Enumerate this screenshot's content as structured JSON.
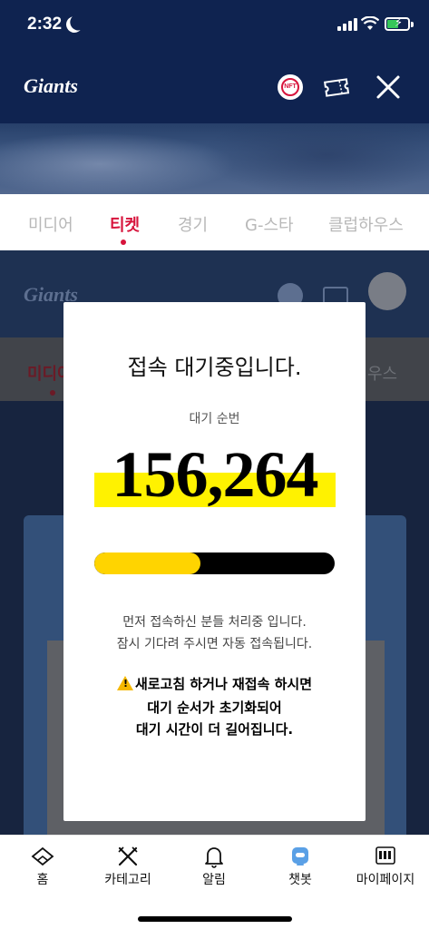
{
  "status_bar": {
    "time": "2:32"
  },
  "header": {
    "logo": "Giants",
    "nft_label": "NFT"
  },
  "tabs": [
    {
      "label": "미디어",
      "active": false
    },
    {
      "label": "티켓",
      "active": true
    },
    {
      "label": "경기",
      "active": false
    },
    {
      "label": "G-스타",
      "active": false
    },
    {
      "label": "클럽하우스",
      "active": false
    }
  ],
  "background_page": {
    "logo": "Giants",
    "tab_left": "미디어",
    "tab_right": "우스"
  },
  "modal": {
    "title": "접속 대기중입니다.",
    "queue_label": "대기 순번",
    "queue_number": "156,264",
    "progress_percent": 44,
    "note_line1": "먼저 접속하신 분들 처리중 입니다.",
    "note_line2": "잠시 기다려 주시면 자동 접속됩니다.",
    "warning_line1": "새로고침 하거나 재접속 하시면",
    "warning_line2": "대기 순서가 초기화되어",
    "warning_line3": "대기 시간이 더 길어집니다."
  },
  "bottom_nav": [
    {
      "label": "홈",
      "icon": "home-icon"
    },
    {
      "label": "카테고리",
      "icon": "category-icon"
    },
    {
      "label": "알림",
      "icon": "bell-icon"
    },
    {
      "label": "챗봇",
      "icon": "chatbot-icon"
    },
    {
      "label": "마이페이지",
      "icon": "mypage-icon"
    }
  ],
  "colors": {
    "brand_navy": "#0f2350",
    "accent_red": "#d7143c",
    "highlight_yellow": "#fff200",
    "progress_yellow": "#ffd400"
  }
}
